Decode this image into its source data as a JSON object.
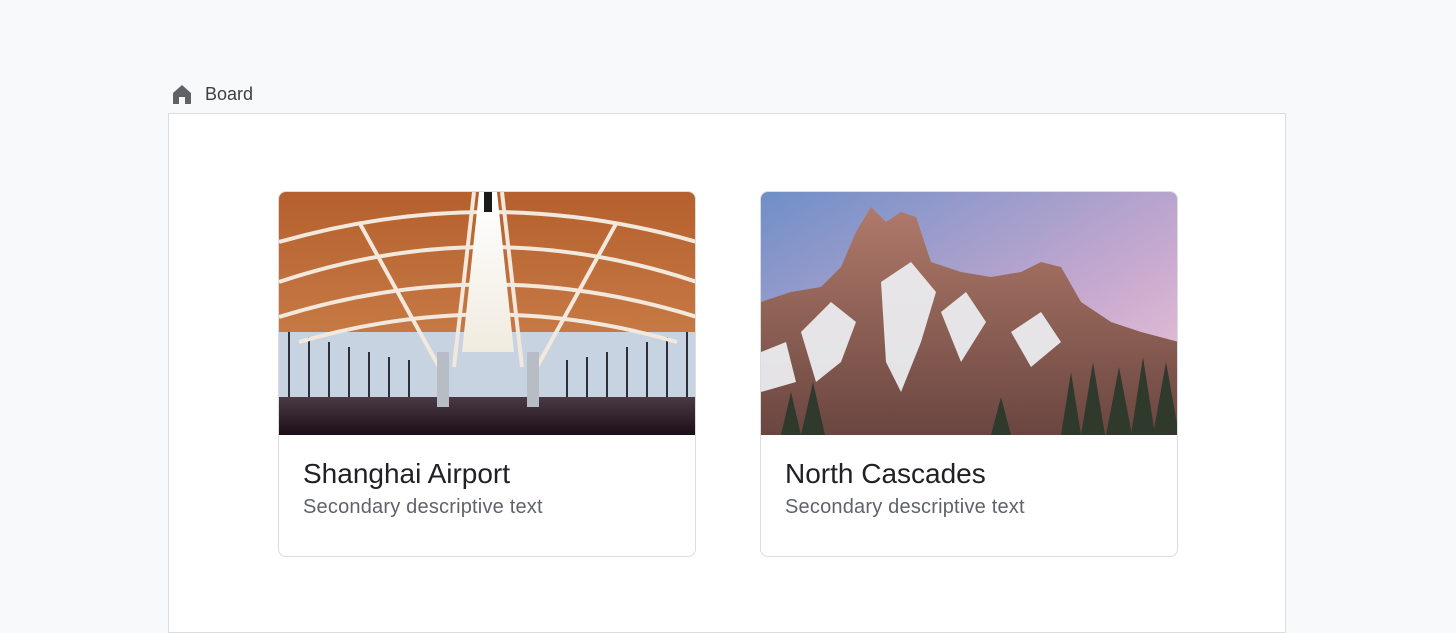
{
  "breadcrumb": {
    "icon": "home-icon",
    "label": "Board"
  },
  "cards": [
    {
      "title": "Shanghai Airport",
      "subtitle": "Secondary descriptive text",
      "image": "airport-interior-image"
    },
    {
      "title": "North Cascades",
      "subtitle": "Secondary descriptive text",
      "image": "mountain-peaks-image"
    }
  ],
  "colors": {
    "page_background": "#f8f9fa",
    "board_background": "#ffffff",
    "border": "#dadce0",
    "title_text": "#202124",
    "secondary_text": "#5f6368"
  }
}
